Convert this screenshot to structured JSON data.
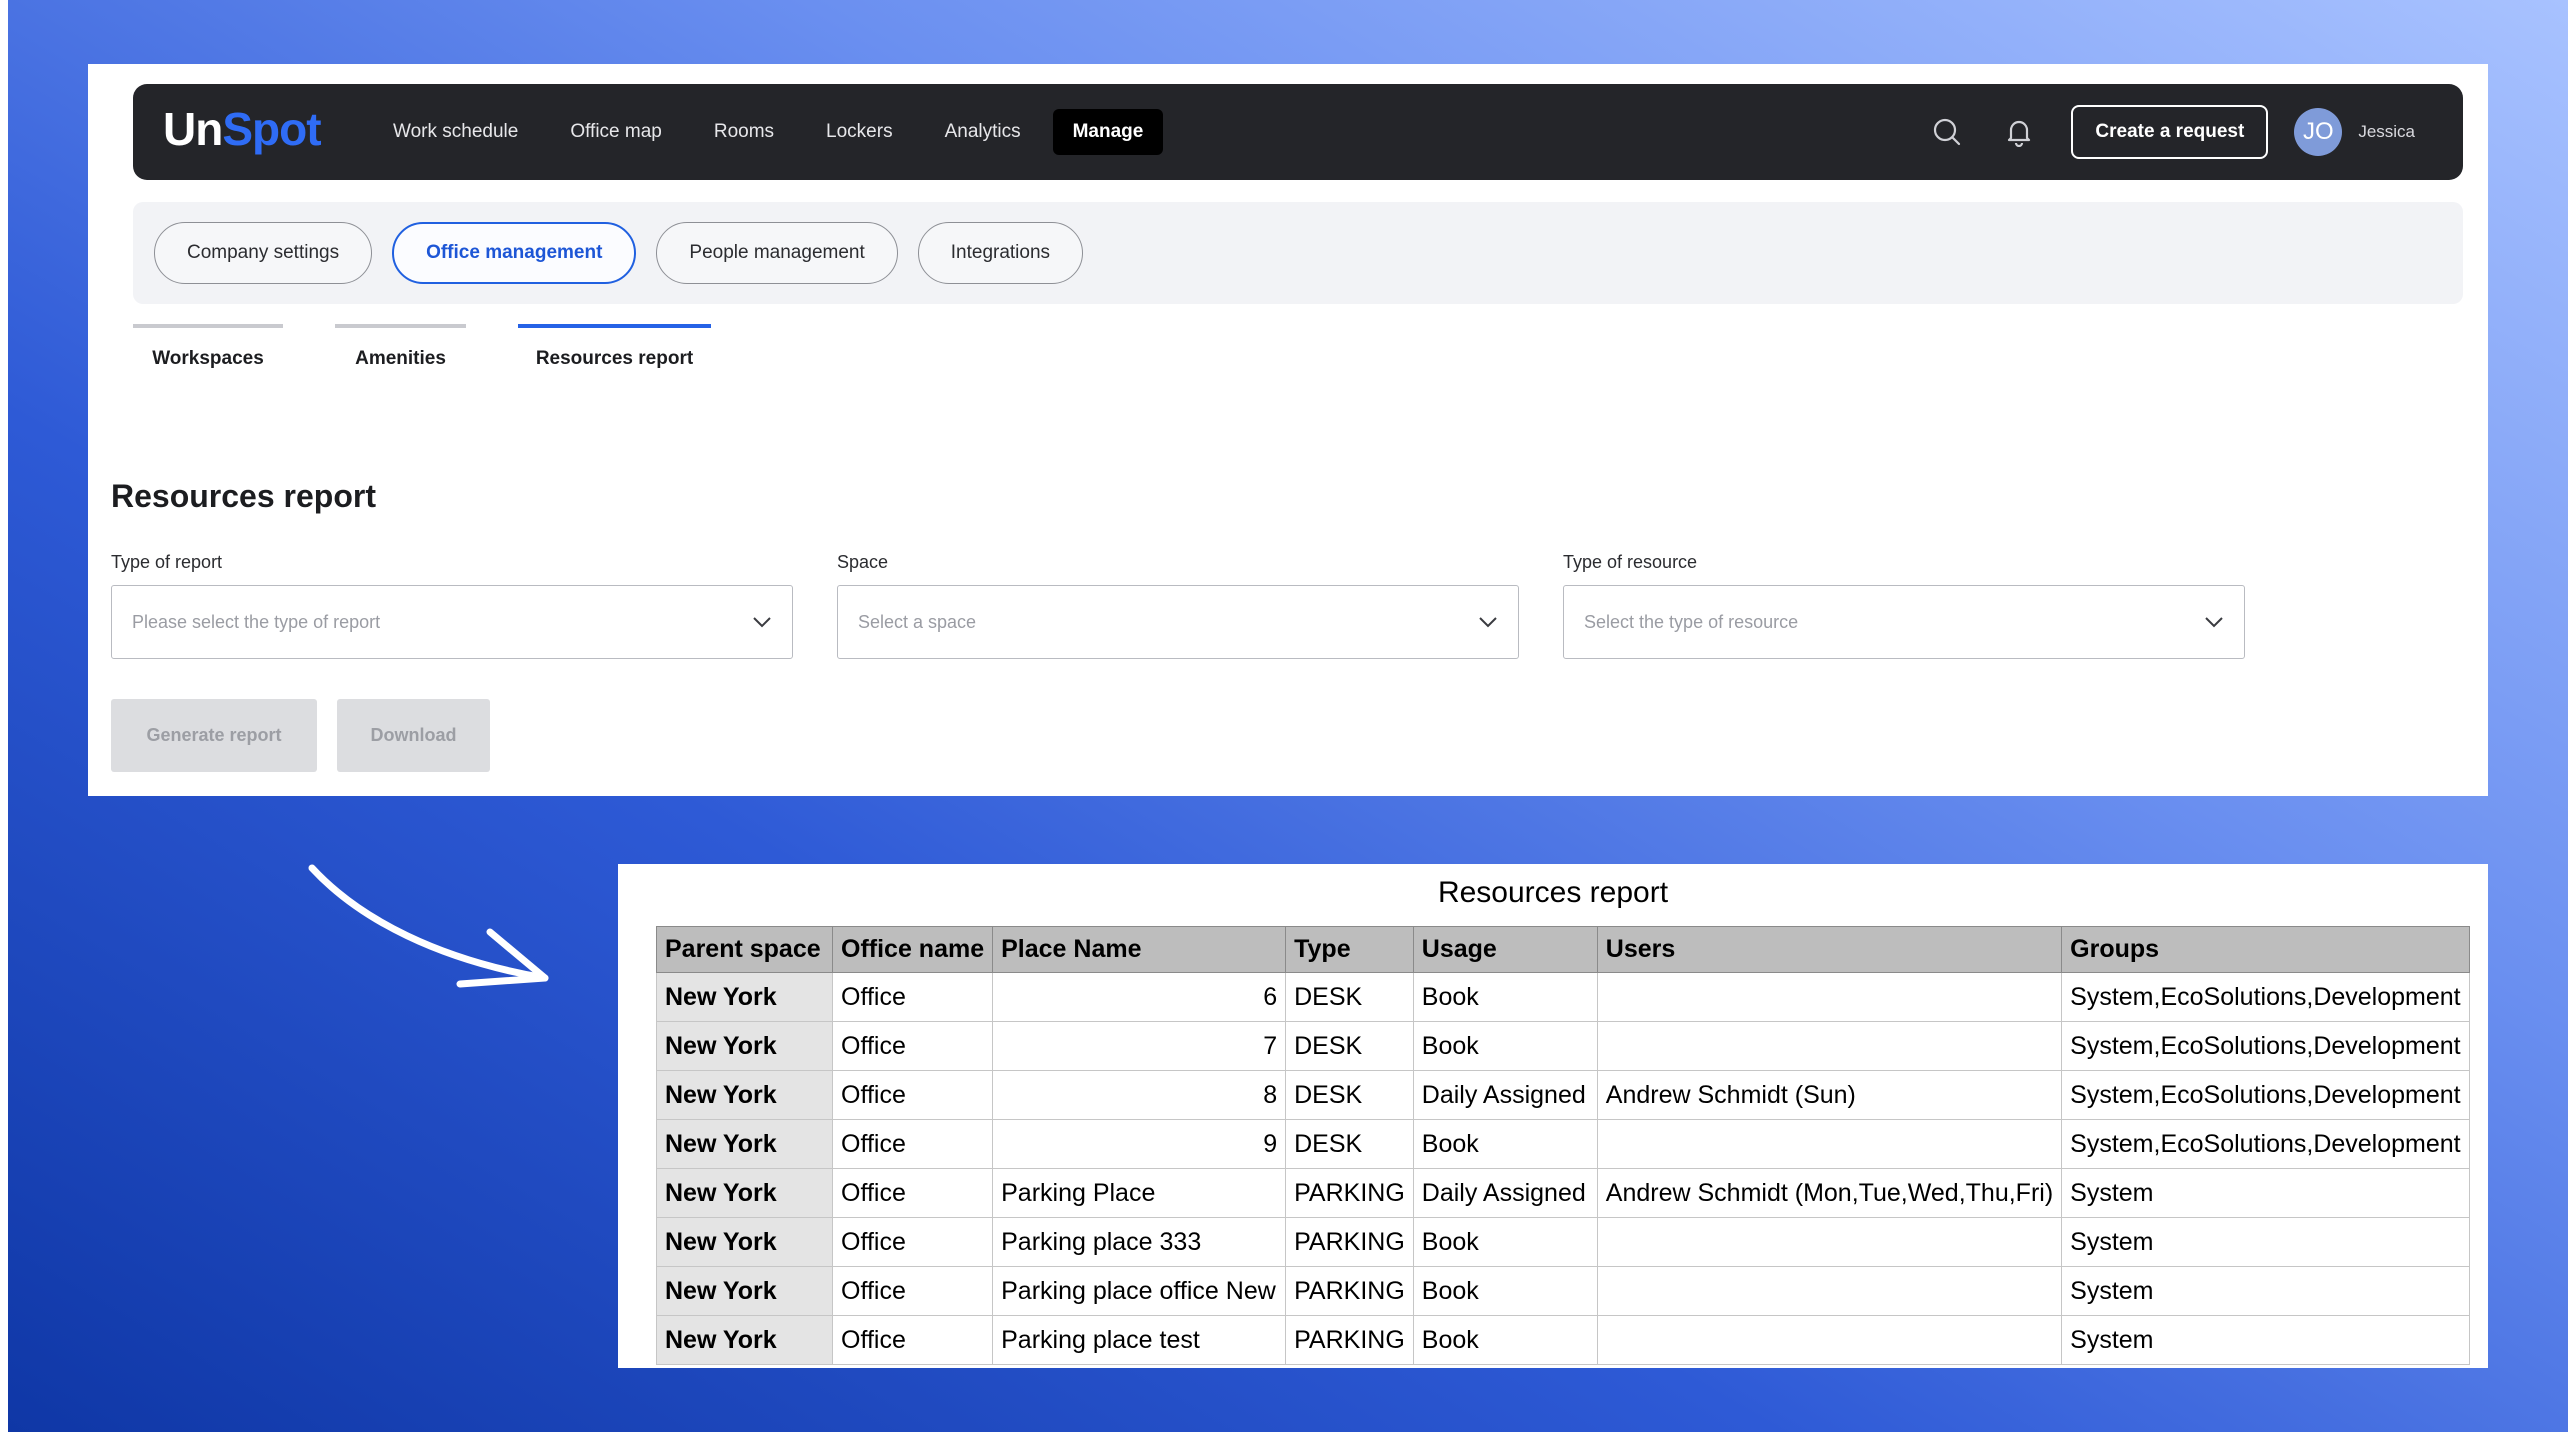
{
  "brand": {
    "logo_part1": "Un",
    "logo_part2": "Spot"
  },
  "topnav": {
    "items": [
      "Work schedule",
      "Office map",
      "Rooms",
      "Lockers",
      "Analytics",
      "Manage"
    ],
    "active": "Manage",
    "create_button": "Create a request",
    "avatar_initials": "JO",
    "user_name": "Jessica",
    "icons": [
      "search-icon",
      "bell-icon"
    ]
  },
  "subnav": {
    "pills": [
      "Company settings",
      "Office management",
      "People management",
      "Integrations"
    ],
    "active": "Office management"
  },
  "tabs": {
    "items": [
      "Workspaces",
      "Amenities",
      "Resources report"
    ],
    "active": "Resources report"
  },
  "form": {
    "title": "Resources report",
    "type_of_report": {
      "label": "Type of report",
      "placeholder": "Please select the type of report"
    },
    "space": {
      "label": "Space",
      "placeholder": "Select a space"
    },
    "type_of_resource": {
      "label": "Type of resource",
      "placeholder": "Select the type of resource"
    },
    "generate_button": "Generate report",
    "download_button": "Download"
  },
  "report_preview": {
    "title": "Resources report",
    "columns": [
      "Parent space",
      "Office name",
      "Place Name",
      "Type",
      "Usage",
      "Users",
      "Groups"
    ],
    "rows": [
      [
        "New York",
        "Office",
        "6",
        "DESK",
        "Book",
        "",
        "System,EcoSolutions,Development"
      ],
      [
        "New York",
        "Office",
        "7",
        "DESK",
        "Book",
        "",
        "System,EcoSolutions,Development"
      ],
      [
        "New York",
        "Office",
        "8",
        "DESK",
        "Daily Assigned",
        "Andrew Schmidt (Sun)",
        "System,EcoSolutions,Development"
      ],
      [
        "New York",
        "Office",
        "9",
        "DESK",
        "Book",
        "",
        "System,EcoSolutions,Development"
      ],
      [
        "New York",
        "Office",
        "Parking Place",
        "PARKING",
        "Daily Assigned",
        "Andrew Schmidt (Mon,Tue,Wed,Thu,Fri)",
        "System"
      ],
      [
        "New York",
        "Office",
        "Parking place 333",
        "PARKING",
        "Book",
        "",
        "System"
      ],
      [
        "New York",
        "Office",
        "Parking place office New",
        "PARKING",
        "Book",
        "",
        "System"
      ],
      [
        "New York",
        "Office",
        "Parking place test",
        "PARKING",
        "Book",
        "",
        "System"
      ]
    ]
  },
  "colors": {
    "accent": "#2f6cf5",
    "topbar": "#242529",
    "background_gradient_start": "#0f37a6",
    "background_gradient_end": "#a8c2ff"
  }
}
